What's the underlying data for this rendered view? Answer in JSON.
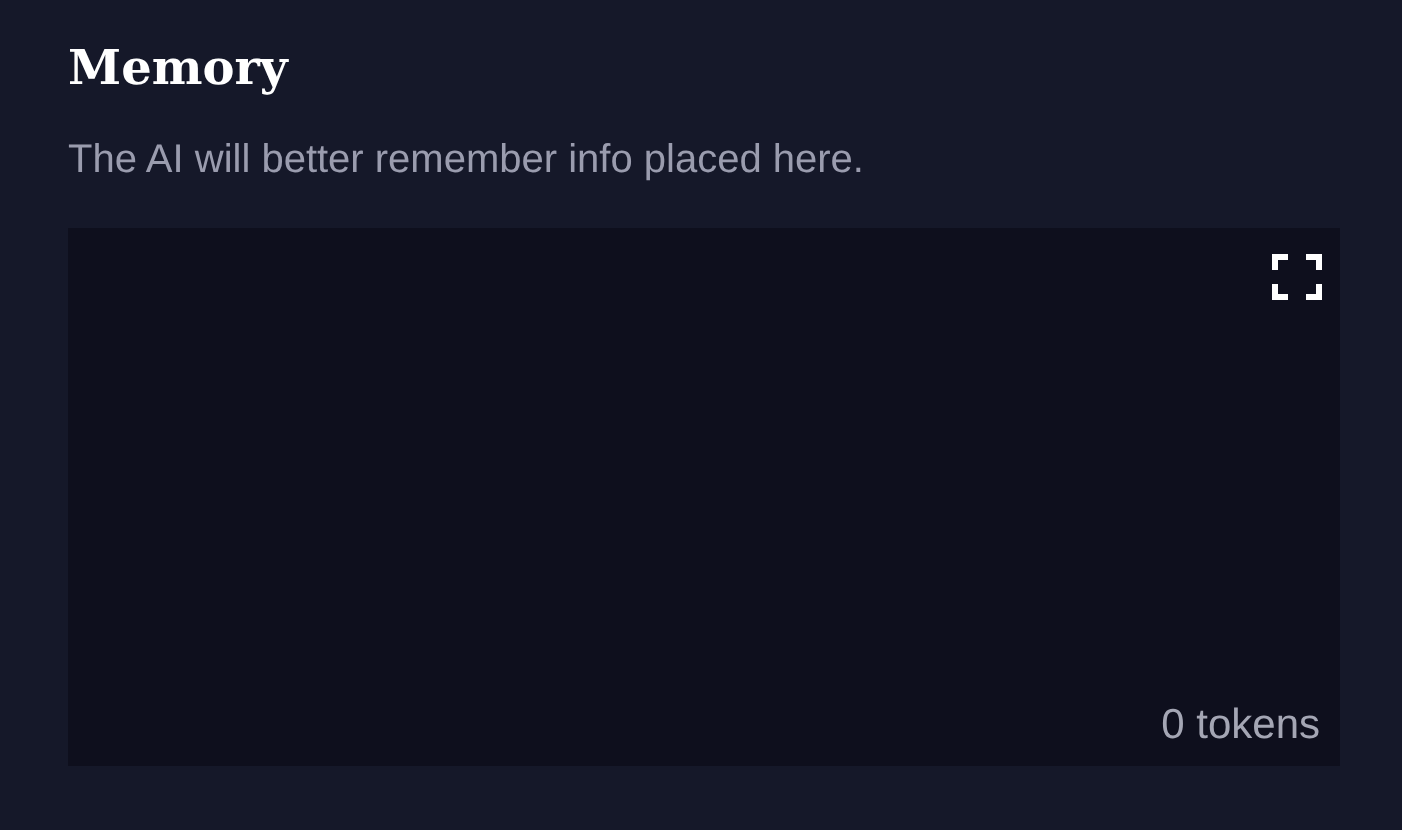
{
  "section": {
    "title": "Memory",
    "description": "The AI will better remember info placed here."
  },
  "editor": {
    "token_count": "0 tokens"
  }
}
